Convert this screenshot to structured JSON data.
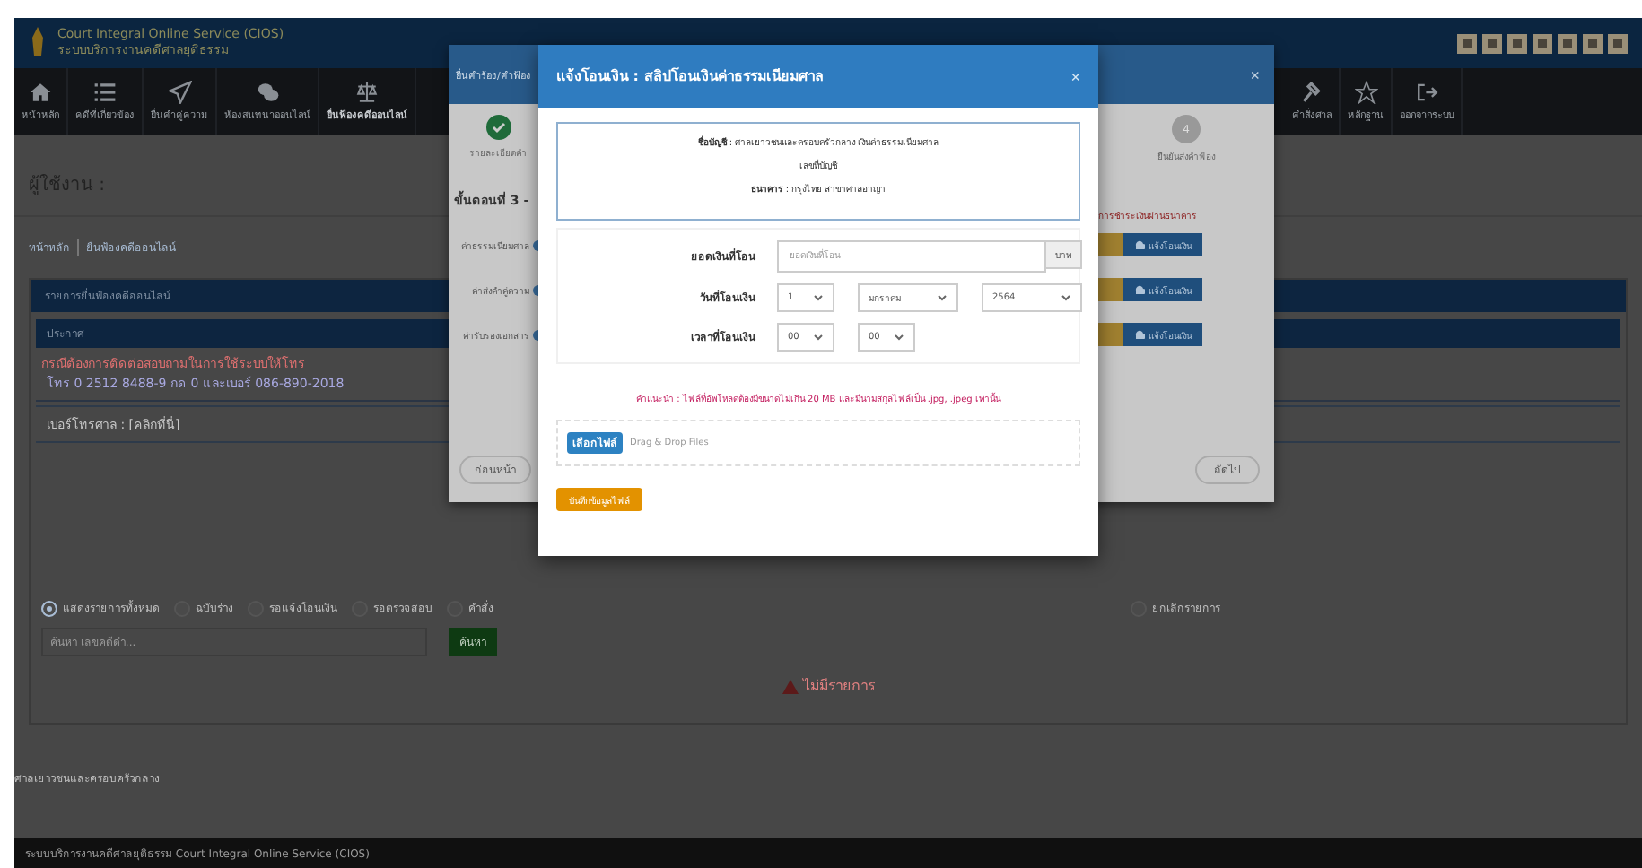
{
  "header": {
    "title": "Court Integral Online Service (CIOS)",
    "subtitle": "ระบบบริการงานคดีศาลยุติธรรม"
  },
  "nav": {
    "left": [
      {
        "label": "หน้าหลัก",
        "selected": false
      },
      {
        "label": "คดีที่เกี่ยวข้อง",
        "selected": false
      },
      {
        "label": "ยื่นคำคู่ความ",
        "selected": false
      },
      {
        "label": "ห้องสนทนาออนไลน์",
        "selected": false
      },
      {
        "label": "ยื่นฟ้องคดีออนไลน์",
        "selected": true
      }
    ],
    "right": [
      {
        "label": "คำสั่งศาล"
      },
      {
        "label": "หลักฐาน"
      },
      {
        "label": "ออกจากระบบ"
      }
    ]
  },
  "user_label": "ผู้ใช้งาน :",
  "breadcrumb": [
    "หน้าหลัก",
    "ยื่นฟ้องคดีออนไลน์"
  ],
  "panel": {
    "title": "รายการยื่นฟ้องคดีออนไลน์",
    "notice_title": "ประกาศ",
    "notice_lines": [
      "กรณีต้องการติดต่อสอบถามในการใช้ระบบให้โทร",
      "โทร 0 2512 8488-9 กด 0 และเบอร์ 086-890-2018"
    ],
    "court_phone": "เบอร์โทรศาล : [คลิกที่นี่]",
    "filters_left": [
      {
        "label": "แสดงรายการทั้งหมด",
        "selected": true
      },
      {
        "label": "ฉบับร่าง",
        "selected": false
      },
      {
        "label": "รอแจ้งโอนเงิน",
        "selected": false
      },
      {
        "label": "รอตรวจสอบ",
        "selected": false
      },
      {
        "label": "คำสั่ง",
        "selected": false
      }
    ],
    "filters_right": [
      {
        "label": "ยกเลิกรายการ",
        "selected": false
      }
    ],
    "search_placeholder": "ค้นหา เลขคดีดำ...",
    "search_button": "ค้นหา",
    "empty": "ไม่มีรายการ"
  },
  "court_name": "ศาลเยาวชนและครอบครัวกลาง",
  "footer": "ระบบบริการงานคดีศาลยุติธรรม  Court Integral Online Service (CIOS)",
  "back_dialog": {
    "title": "ยื่นคำร้อง/คำฟ้อง",
    "close": "×",
    "step_left": "รายละเอียดคำ",
    "step_right_number": "4",
    "step_right": "ยืนยันส่งคำฟ้อง",
    "heading": "ขั้นตอนที่ 3 -",
    "note": "การชำระเงินผ่านธนาคาร",
    "rows": [
      {
        "label": "ค่าธรรมเนียมศาล",
        "button": "แจ้งโอนเงิน"
      },
      {
        "label": "ค่าส่งคำคู่ความ",
        "button": "แจ้งโอนเงิน"
      },
      {
        "label": "ค่ารับรองเอกสาร",
        "button": "แจ้งโอนเงิน"
      }
    ],
    "prev": "ก่อนหน้า",
    "next": "ถัดไป"
  },
  "dialog": {
    "title": "แจ้งโอนเงิน : สลิปโอนเงินค่าธรรมเนียมศาล",
    "close": "×",
    "info": [
      "**ชื่อบัญชี** : ศาลเยาวชนและครอบครัวกลาง เงินค่าธรรมเนียมศาล",
      "เลขที่บัญชี",
      "**ธนาคาร** : กรุงไทย สาขาศาลอาญา"
    ],
    "amount_label": "ยอดเงินที่โอน",
    "amount_placeholder": "ยอดเงินที่โอน",
    "amount_unit": "บาท",
    "date_label": "วันที่โอนเงิน",
    "date": [
      "1",
      "มกราคม",
      "2564"
    ],
    "time_label": "เวลาที่โอนเงิน",
    "time": [
      "00",
      "00"
    ],
    "hint": "คำแนะนำ : ไฟล์ที่อัพโหลดต้องมีขนาดไม่เกิน 20 MB และมีนามสกุลไฟล์เป็น .jpg, .jpeg เท่านั้น",
    "choose_file": "เลือกไฟล์",
    "drop_text": "Drag & Drop Files",
    "save": "บันทึกข้อมูลไฟล์"
  }
}
